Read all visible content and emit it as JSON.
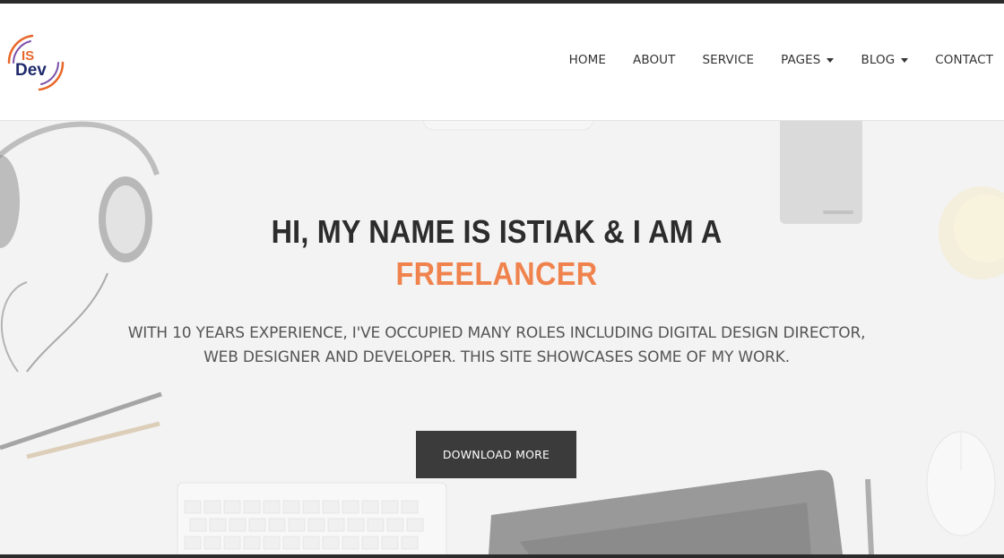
{
  "brand": {
    "logo_text": "Dev",
    "logo_mark": "IS",
    "colors": {
      "orange": "#e8672a",
      "navy": "#1f2a6b",
      "purple": "#7b4fa8"
    }
  },
  "nav": {
    "items": [
      {
        "label": "HOME",
        "has_dropdown": false
      },
      {
        "label": "ABOUT",
        "has_dropdown": false
      },
      {
        "label": "SERVICE",
        "has_dropdown": false
      },
      {
        "label": "PAGES",
        "has_dropdown": true,
        "icon": "caret-down-icon"
      },
      {
        "label": "BLOG",
        "has_dropdown": true,
        "icon": "caret-down-icon"
      },
      {
        "label": "CONTACT",
        "has_dropdown": false
      }
    ]
  },
  "hero": {
    "title": "HI, MY NAME IS ISTIAK & I AM A",
    "highlight": "FREELANCER",
    "subtitle_line1": "WITH 10 YEARS EXPERIENCE, I'VE OCCUPIED MANY ROLES INCLUDING DIGITAL DESIGN DIRECTOR,",
    "subtitle_line2": "WEB DESIGNER AND DEVELOPER. THIS SITE SHOWCASES SOME OF MY WORK.",
    "cta_label": "DOWNLOAD MORE",
    "accent_color": "#f0834d",
    "background_icons": [
      "headphones-icon",
      "pencil-icon",
      "keyboard-icon",
      "tablet-icon",
      "mouse-icon",
      "coffee-cup-icon",
      "hard-drive-icon"
    ]
  }
}
